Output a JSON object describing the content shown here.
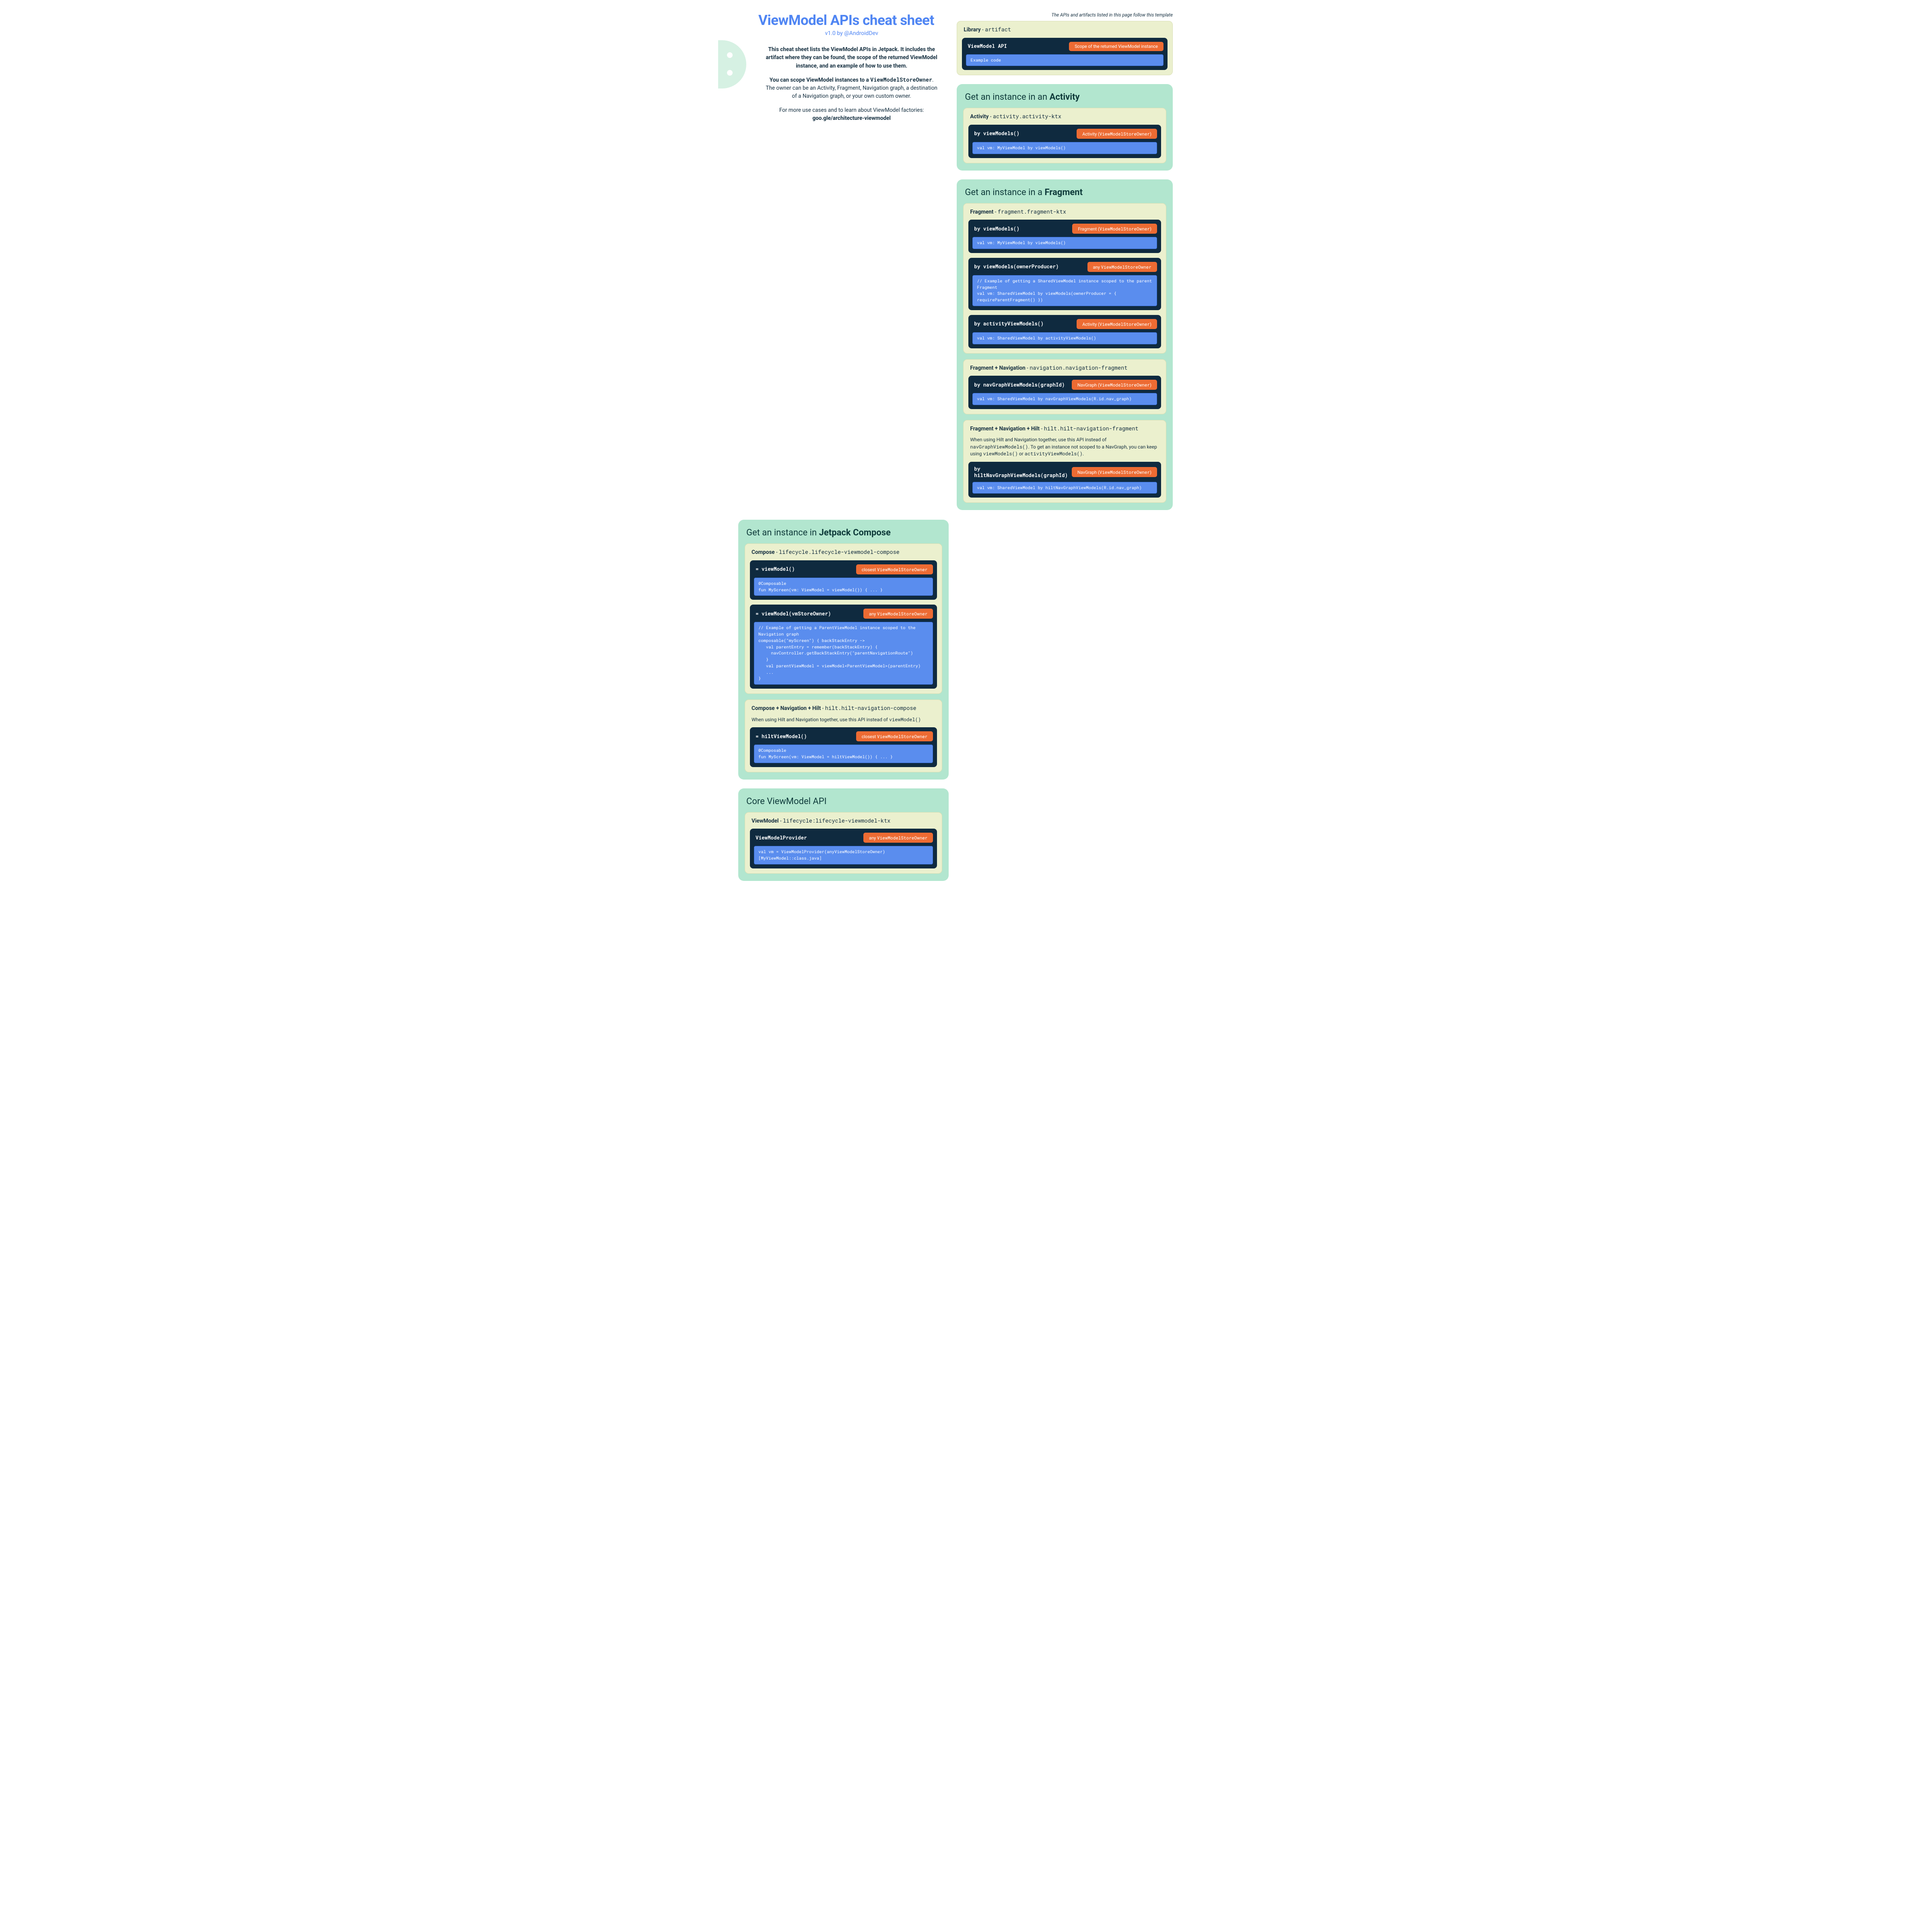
{
  "hero": {
    "title": "ViewModel APIs cheat sheet",
    "byline_prefix": "v1.0 by ",
    "byline_handle": "@AndroidDev",
    "p1": "This cheat sheet lists the ViewModel APIs in Jetpack. It includes the artifact where they can be found, the scope of the returned ViewModel instance, and an example of how to use them.",
    "p2a": "You can scope ViewModel instances to a ",
    "p2_mono": "ViewModelStoreOwner",
    "p2b": ". The owner can be an Activity, Fragment, Navigation graph, a destination of a Navigation graph, or your own custom owner.",
    "p3": "For more use cases and to learn about ViewModel factories:",
    "p3_link": "goo.gle/architecture-viewmodel"
  },
  "template": {
    "note": "The APIs and artifacts listed in this page follow this template",
    "lib_name": "Library",
    "lib_dash": " - ",
    "lib_artifact": "artifact",
    "api_name": "ViewModel API",
    "scope": "Scope of the returned ViewModel instance",
    "code": "Example code"
  },
  "sections": {
    "compose": {
      "title_pre": "Get an instance in ",
      "title_bold": "Jetpack Compose",
      "cards": [
        {
          "lib_name": "Compose",
          "lib_artifact": "lifecycle.lifecycle-viewmodel-compose",
          "blocks": [
            {
              "api": "= viewModel()",
              "scope_pre": "closest ",
              "scope_mono": "ViewModelStoreOwner",
              "scope_post": "",
              "code": "@Composable\nfun MyScreen(vm: ViewModel = viewModel()) { ... }"
            },
            {
              "api": "= viewModel(vmStoreOwner)",
              "scope_pre": "any ",
              "scope_mono": "ViewModelStoreOwner",
              "scope_post": "",
              "code": "// Example of getting a ParentViewModel instance scoped to the Navigation graph\ncomposable(\"myScreen\") { backStackEntry ->\n   val parentEntry = remember(backStackEntry) {\n     navController.getBackStackEntry(\"parentNavigationRoute\")\n   }\n   val parentViewModel = viewModel<ParentViewModel>(parentEntry)\n   ...\n}"
            }
          ]
        },
        {
          "lib_name": "Compose + Navigation + Hilt",
          "lib_artifact": "hilt.hilt-navigation-compose",
          "note_pre": "When using Hilt and Navigation together, use this API instead of ",
          "note_mono": "viewModel()",
          "blocks": [
            {
              "api": "= hiltViewModel()",
              "scope_pre": "closest ",
              "scope_mono": "ViewModelStoreOwner",
              "scope_post": "",
              "code": "@Composable\nfun MyScreen(vm: ViewModel = hiltViewModel()) { ... }"
            }
          ]
        }
      ]
    },
    "core": {
      "title_pre": "Core ViewModel API",
      "title_bold": "",
      "cards": [
        {
          "lib_name": "ViewModel",
          "lib_artifact": "lifecycle:lifecycle-viewmodel-ktx",
          "blocks": [
            {
              "api": "ViewModelProvider",
              "scope_pre": "any ",
              "scope_mono": "ViewModelStoreOwner",
              "scope_post": "",
              "code": "val vm = ViewModelProvider(anyViewModelStoreOwner)[MyViewModel::class.java]"
            }
          ]
        }
      ]
    },
    "activity": {
      "title_pre": "Get an instance in an ",
      "title_bold": "Activity",
      "cards": [
        {
          "lib_name": "Activity",
          "lib_artifact": "activity.activity-ktx",
          "blocks": [
            {
              "api": "by viewModels()",
              "scope_pre": "Activity (",
              "scope_mono": "ViewModelStoreOwner",
              "scope_post": ")",
              "code": "val vm: MyViewModel by viewModels()"
            }
          ]
        }
      ]
    },
    "fragment": {
      "title_pre": "Get an instance in a ",
      "title_bold": "Fragment",
      "cards": [
        {
          "lib_name": "Fragment",
          "lib_artifact": "fragment.fragment-ktx",
          "blocks": [
            {
              "api": "by viewModels()",
              "scope_pre": "Fragment (",
              "scope_mono": "ViewModelStoreOwner",
              "scope_post": ")",
              "code": "val vm: MyViewModel by viewModels()"
            },
            {
              "api": "by viewModels(ownerProducer)",
              "scope_pre": "any ",
              "scope_mono": "ViewModelStoreOwner",
              "scope_post": "",
              "code": "// Example of getting a SharedViewModel instance scoped to the parent Fragment\nval vm: SharedViewModel by viewModels(ownerProducer = { requireParentFragment() })"
            },
            {
              "api": "by activityViewModels()",
              "scope_pre": "Activity (",
              "scope_mono": "ViewModelStoreOwner",
              "scope_post": ")",
              "code": "val vm: SharedViewModel by activityViewModels()"
            }
          ]
        },
        {
          "lib_name": "Fragment + Navigation",
          "lib_artifact": "navigation.navigation-fragment",
          "blocks": [
            {
              "api": "by navGraphViewModels(graphId)",
              "scope_pre": "NavGraph (",
              "scope_mono": "ViewModelStoreOwner",
              "scope_post": ")",
              "code": "val vm: SharedViewModel by navGraphViewModels(R.id.nav_graph)"
            }
          ]
        },
        {
          "lib_name": "Fragment + Navigation + Hilt",
          "lib_artifact": "hilt.hilt-navigation-fragment",
          "note_pre": "When using Hilt and Navigation together, use this API instead of ",
          "note_mono": "navGraphViewModels()",
          "note_post": ". To get an instance not scoped to a NavGraph, you can keep using ",
          "note_mono2": "viewModels()",
          "note_post2": " or ",
          "note_mono3": "activityViewModels()",
          "note_post3": ".",
          "blocks": [
            {
              "api": "by hiltNavGraphViewModels(graphId)",
              "scope_pre": "NavGraph (",
              "scope_mono": "ViewModelStoreOwner",
              "scope_post": ")",
              "code": "val vm: SharedViewModel by hiltNavGraphViewModels(R.id.nav_graph)"
            }
          ]
        }
      ]
    }
  }
}
